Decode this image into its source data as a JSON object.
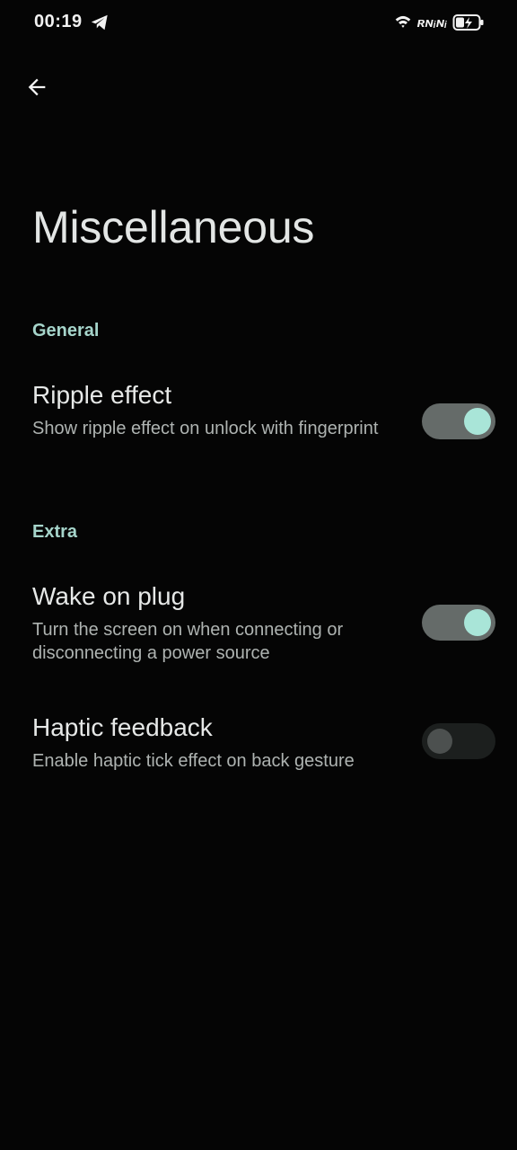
{
  "status_bar": {
    "time": "00:19",
    "telegram_icon": "telegram-icon",
    "wifi_icon": "wifi-icon",
    "signal_text": "ʀɴᵢɴᵢ",
    "battery_icon": "battery-charging-icon"
  },
  "header": {
    "back_icon": "arrow-back-icon",
    "title": "Miscellaneous"
  },
  "sections": [
    {
      "label": "General",
      "items": [
        {
          "title": "Ripple effect",
          "description": "Show ripple effect on unlock with fingerprint",
          "enabled": true
        }
      ]
    },
    {
      "label": "Extra",
      "items": [
        {
          "title": "Wake on plug",
          "description": "Turn the screen on when connecting or disconnecting a power source",
          "enabled": true
        },
        {
          "title": "Haptic feedback",
          "description": "Enable haptic tick effect on back gesture",
          "enabled": false
        }
      ]
    }
  ],
  "colors": {
    "background": "#050505",
    "accent": "#a6d5cb",
    "toggle_on_track": "#656b69",
    "toggle_on_knob": "#a9e5d8",
    "toggle_off_track": "#1c1f1e",
    "toggle_off_knob": "#4c504f"
  }
}
